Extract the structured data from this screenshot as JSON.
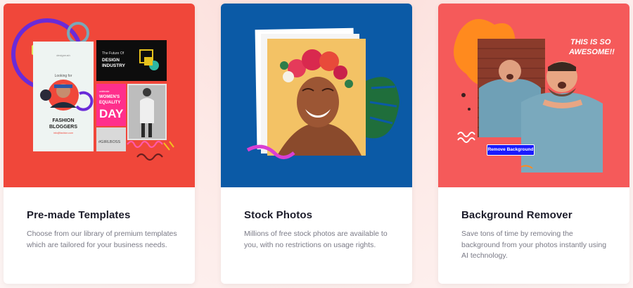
{
  "colors": {
    "card1_bg": "#f0473a",
    "card2_bg": "#0b5aa6",
    "card3_bg": "#f55a5a",
    "button_blue": "#1a1aff",
    "title_color": "#1c1c2a",
    "desc_color": "#7a7a86"
  },
  "cards": [
    {
      "title": "Pre-made Templates",
      "description": "Choose from our library of premium templates which are tailored for your business needs.",
      "image_texts": {
        "future_line": "The Future Of",
        "design_industry": "DESIGN\nINDUSTRY",
        "women_equality": "WOMEN'S\nEQUALITY",
        "day": "DAY",
        "fashion_bloggers": "FASHION\nBLOGGERS",
        "hashtag": "#GIRLBOSS",
        "looking_for": "Looking for"
      }
    },
    {
      "title": "Stock Photos",
      "description": "Millions of free stock photos are available to you, with no restrictions on usage rights."
    },
    {
      "title": "Background Remover",
      "description": "Save tons of time by removing the background from your photos instantly using AI technology.",
      "image_texts": {
        "speech": "THIS IS SO\nAWESOME!!",
        "button": "Remove Background"
      }
    }
  ]
}
